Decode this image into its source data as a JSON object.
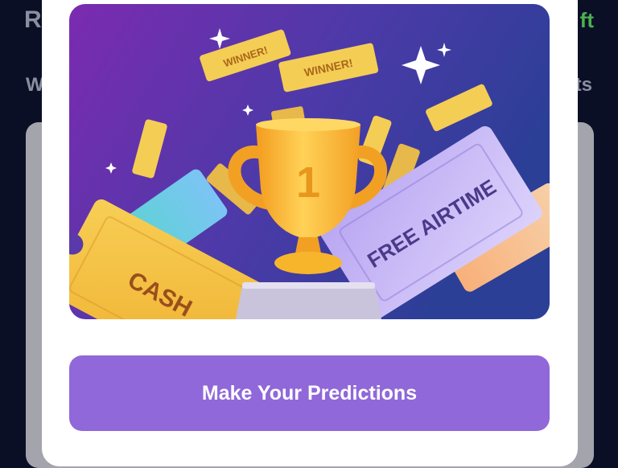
{
  "background": {
    "title_fragment": "R",
    "right_action_fragment": "ft",
    "tab_left_fragment": "W",
    "tab_right_fragment": "ts"
  },
  "modal": {
    "hero": {
      "trophy_number": "1",
      "ticket_left": "CASH",
      "ticket_right": "FREE AIRTIME",
      "confetti_text": "WINNER!"
    },
    "cta_label": "Make Your Predictions"
  },
  "colors": {
    "cta": "#9068d9",
    "hero_gradient_start": "#7b2bb0",
    "hero_gradient_end": "#2b3f96",
    "trophy": "#f7b52c",
    "ticket_cash": "#f5c445",
    "ticket_airtime": "#c9b8f5"
  }
}
